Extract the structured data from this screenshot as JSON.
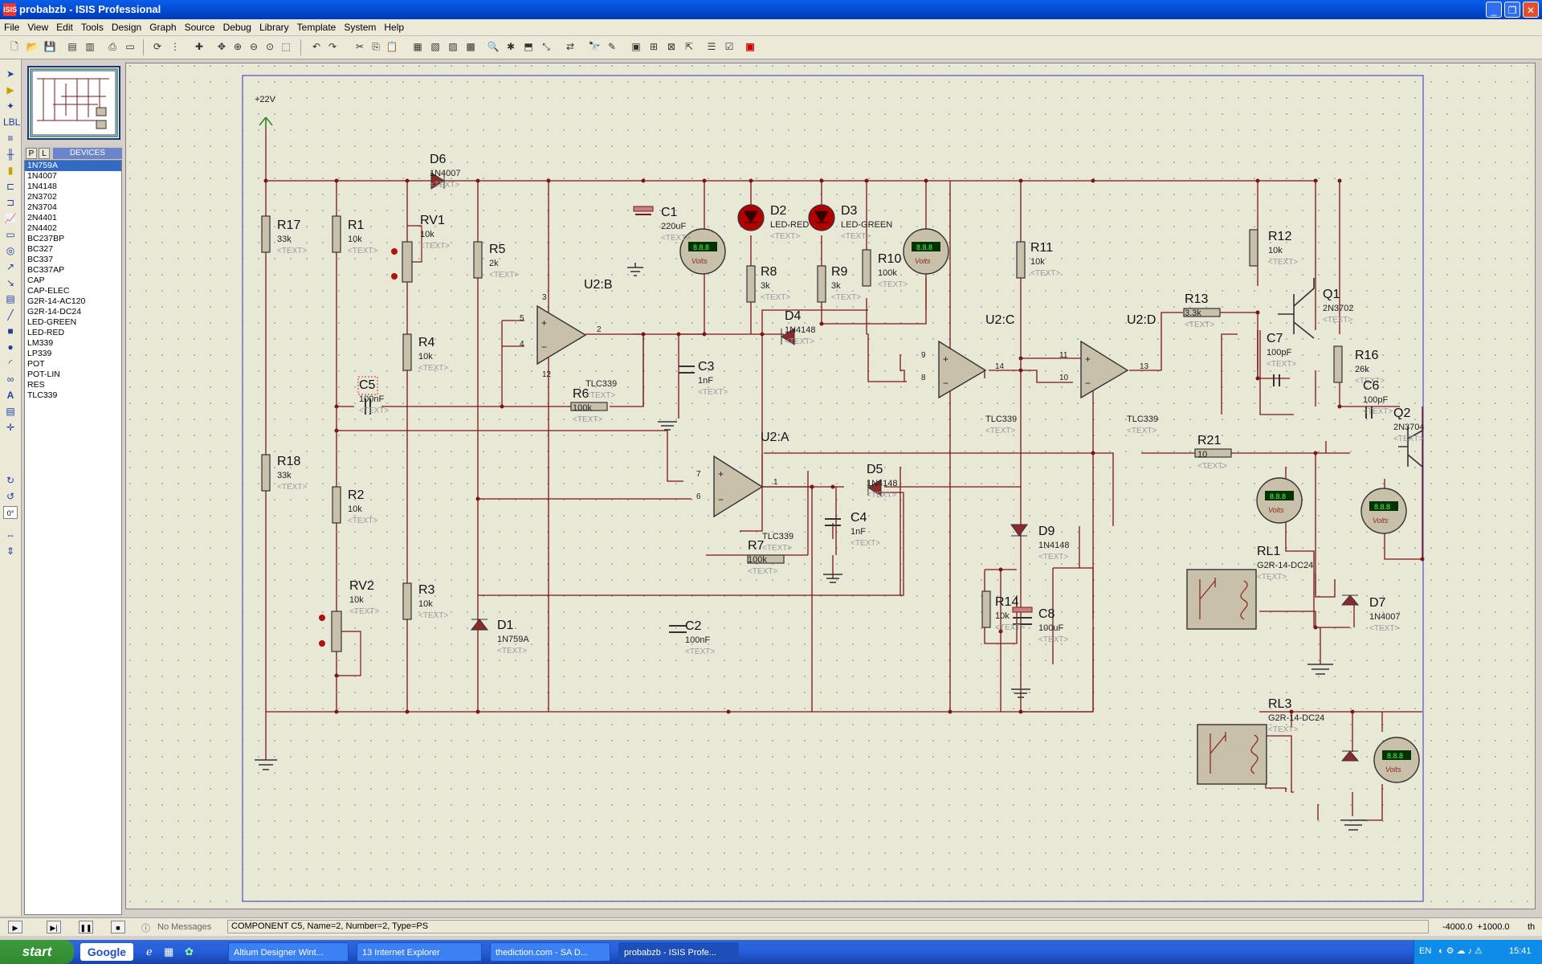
{
  "window": {
    "title": "probabzb - ISIS Professional",
    "app_icon": "ISIS"
  },
  "menu": [
    "File",
    "View",
    "Edit",
    "Tools",
    "Design",
    "Graph",
    "Source",
    "Debug",
    "Library",
    "Template",
    "System",
    "Help"
  ],
  "sidebar": {
    "tabs": [
      "P",
      "L"
    ],
    "devices_label": "DEVICES",
    "devices": [
      "1N759A",
      "1N4007",
      "1N4148",
      "2N3702",
      "2N3704",
      "2N4401",
      "2N4402",
      "BC237BP",
      "BC327",
      "BC337",
      "BC337AP",
      "CAP",
      "CAP-ELEC",
      "G2R-14-AC120",
      "G2R-14-DC24",
      "LED-GREEN",
      "LED-RED",
      "LM339",
      "LP339",
      "POT",
      "POT-LIN",
      "RES",
      "TLC339"
    ],
    "selected_device": "1N759A",
    "rotation": "0°"
  },
  "schematic": {
    "supply": "+22V",
    "text_placeholder": "<TEXT>",
    "meter_unit": "Volts",
    "components": [
      {
        "ref": "R17",
        "value": "33k"
      },
      {
        "ref": "R18",
        "value": "33k"
      },
      {
        "ref": "R1",
        "value": "10k"
      },
      {
        "ref": "R2",
        "value": "10k"
      },
      {
        "ref": "RV1",
        "value": "10k"
      },
      {
        "ref": "RV2",
        "value": "10k"
      },
      {
        "ref": "R4",
        "value": "10k"
      },
      {
        "ref": "R3",
        "value": "10k"
      },
      {
        "ref": "D6",
        "value": "1N4007"
      },
      {
        "ref": "R5",
        "value": "2k"
      },
      {
        "ref": "C5",
        "value": "100nF"
      },
      {
        "ref": "R6",
        "value": "100k"
      },
      {
        "ref": "D1",
        "value": "1N759A"
      },
      {
        "ref": "C1",
        "value": "220uF"
      },
      {
        "ref": "C3",
        "value": "1nF"
      },
      {
        "ref": "C2",
        "value": "100nF"
      },
      {
        "ref": "D2",
        "value": "LED-RED"
      },
      {
        "ref": "D3",
        "value": "LED-GREEN"
      },
      {
        "ref": "R8",
        "value": "3k"
      },
      {
        "ref": "R9",
        "value": "3k"
      },
      {
        "ref": "D4",
        "value": "1N4148"
      },
      {
        "ref": "R10",
        "value": "100k"
      },
      {
        "ref": "R7",
        "value": "100k"
      },
      {
        "ref": "C4",
        "value": "1nF"
      },
      {
        "ref": "D5",
        "value": "1N4148"
      },
      {
        "ref": "R11",
        "value": "10k"
      },
      {
        "ref": "D9",
        "value": "1N4148"
      },
      {
        "ref": "R14",
        "value": "10k"
      },
      {
        "ref": "C8",
        "value": "100uF"
      },
      {
        "ref": "R13",
        "value": "3.3k"
      },
      {
        "ref": "R12",
        "value": "10k"
      },
      {
        "ref": "Q1",
        "value": "2N3702"
      },
      {
        "ref": "C7",
        "value": "100pF"
      },
      {
        "ref": "R16",
        "value": "26k"
      },
      {
        "ref": "C6",
        "value": "100pF"
      },
      {
        "ref": "Q2",
        "value": "2N3704"
      },
      {
        "ref": "R21",
        "value": "10"
      },
      {
        "ref": "D7",
        "value": "1N4007"
      },
      {
        "ref": "RL1",
        "value": "G2R-14-DC24"
      },
      {
        "ref": "RL3",
        "value": "G2R-14-DC24"
      }
    ],
    "opamps": [
      {
        "ref": "U2:B",
        "part": "TLC339"
      },
      {
        "ref": "U2:A",
        "part": "TLC339"
      },
      {
        "ref": "U2:C",
        "part": "TLC339"
      },
      {
        "ref": "U2:D",
        "part": "TLC339"
      }
    ],
    "pins": [
      "5",
      "4",
      "3",
      "12",
      "2",
      "7",
      "6",
      "1",
      "9",
      "8",
      "14",
      "11",
      "10",
      "13"
    ]
  },
  "status": {
    "messages": "No Messages",
    "info": "COMPONENT C5, Name=2, Number=2, Type=PS",
    "coords": "-4000.0  +1000.0",
    "units": "th"
  },
  "taskbar": {
    "start": "start",
    "search": "Google",
    "tasks": [
      {
        "label": "Altium Designer Wint...",
        "active": false
      },
      {
        "label": "13 Internet Explorer",
        "active": false
      },
      {
        "label": "thediction.com - SA D...",
        "active": false
      },
      {
        "label": "probabzb - ISIS Profe...",
        "active": true
      }
    ],
    "lang": "EN",
    "clock": "15:41"
  },
  "colors": {
    "wire": "#7a1818",
    "component": "#8a2a2a",
    "fill": "#c8c0a8",
    "sheet": "#3030c0",
    "canvas": "#e9e7d6"
  }
}
